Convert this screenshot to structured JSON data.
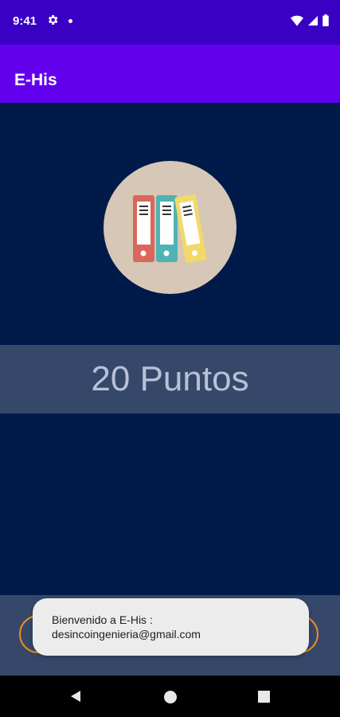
{
  "status_bar": {
    "time": "9:41",
    "icons": [
      "gear-icon",
      "notification-dot",
      "wifi-icon",
      "signal-icon",
      "battery-icon"
    ]
  },
  "app_bar": {
    "title": "E-His"
  },
  "main": {
    "logo_icon": "binders-logo",
    "points_text": "20 Puntos"
  },
  "toast": {
    "line1": "Bienvenido a E-His :",
    "line2": "desincoingenieria@gmail.com"
  },
  "nav_bar": {
    "icons": [
      "back-icon",
      "home-icon",
      "recents-icon"
    ]
  },
  "colors": {
    "status_bar": "#3a00c4",
    "app_bar": "#6200ee",
    "background": "#001a4a",
    "band": "#35486a",
    "button_outline": "#f08a1c"
  }
}
